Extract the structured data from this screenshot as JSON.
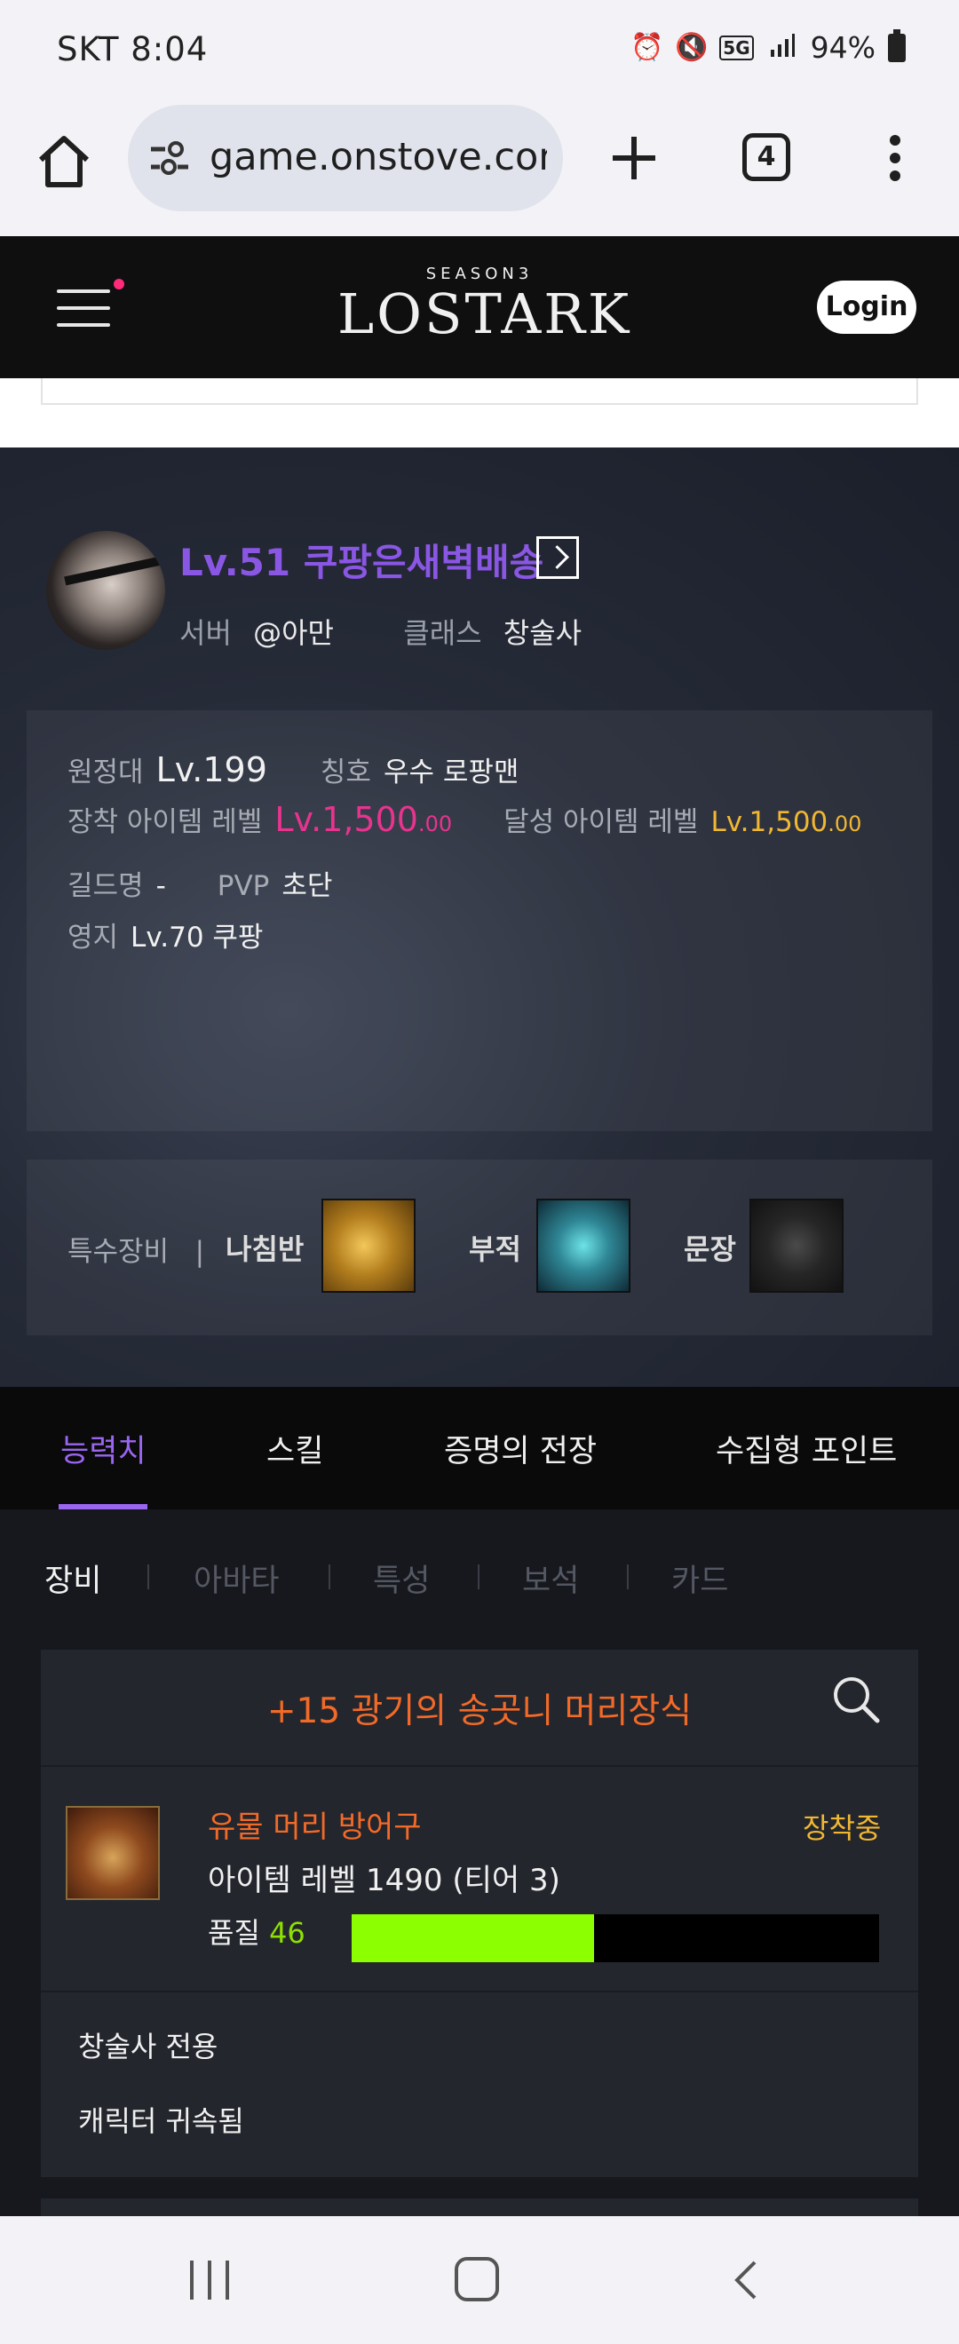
{
  "status_bar": {
    "carrier_time": "SKT 8:04",
    "alarm_icon": "alarm-icon",
    "mute_icon": "mute-icon",
    "network": "5G",
    "battery": "94%"
  },
  "browser": {
    "url": "game.onstove.com",
    "tab_count": "4"
  },
  "site": {
    "logo_season": "SEASON3",
    "logo_name": "LOSTARK",
    "login_label": "Login"
  },
  "character": {
    "name": "Lv.51 쿠팡은새벽배송",
    "server_label": "서버",
    "server": "@아만",
    "class_label": "클래스",
    "class": "창술사"
  },
  "info": {
    "expedition_label": "원정대",
    "expedition": "Lv.199",
    "title_label": "칭호",
    "title": "우수 로팡맨",
    "equip_level_label": "장착 아이템 레벨",
    "equip_level": "Lv.1,500",
    "equip_level_dec": ".00",
    "achieved_level_label": "달성 아이템 레벨",
    "achieved_level": "Lv.1,500",
    "achieved_level_dec": ".00",
    "guild_label": "길드명",
    "guild": "-",
    "pvp_label": "PVP",
    "pvp": "초단",
    "estate_label": "영지",
    "estate": "Lv.70 쿠팡"
  },
  "special_equipment": {
    "label": "특수장비",
    "separator": "|",
    "compass": "나침반",
    "charm": "부적",
    "crest": "문장"
  },
  "tabs": [
    "능력치",
    "스킬",
    "증명의 전장",
    "수집형 포인트"
  ],
  "subtabs": [
    "장비",
    "아바타",
    "특성",
    "보석",
    "카드"
  ],
  "item": {
    "title": "+15 광기의 송곳니 머리장식",
    "type": "유물 머리 방어구",
    "status": "장착중",
    "level": "아이템 레벨 1490 (티어 3)",
    "quality_label": "품질",
    "quality": "46",
    "quality_value": 46,
    "note1": "창술사 전용",
    "note2": "캐릭터 귀속됨"
  },
  "colors": {
    "accent_purple": "#9a66f0",
    "relic_orange": "#f26a28",
    "gold": "#f0b733",
    "pink": "#e8338f",
    "quality_green": "#8cff00"
  }
}
